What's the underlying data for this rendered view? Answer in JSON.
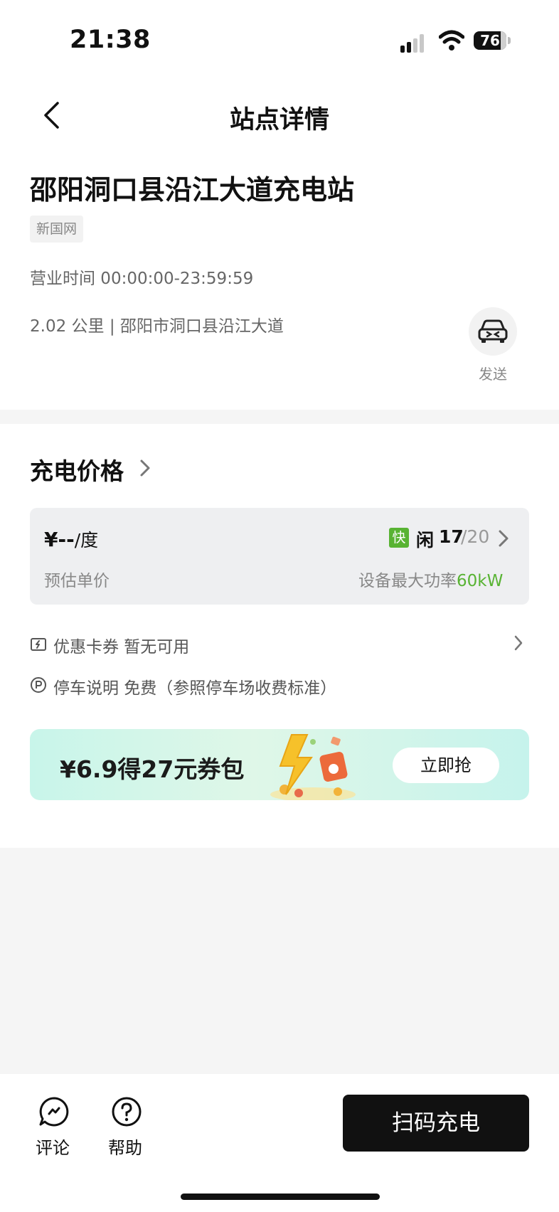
{
  "status_bar": {
    "time": "21:38",
    "battery": "76"
  },
  "header": {
    "title": "站点详情",
    "back_icon": "chevron-left-icon"
  },
  "station": {
    "name": "邵阳洞口县沿江大道充电站",
    "operator_tag": "新国网",
    "hours": "营业时间 00:00:00-23:59:59",
    "address": "2.02 公里 | 邵阳市洞口县沿江大道",
    "send_label": "发送",
    "send_icon": "car-icon"
  },
  "price": {
    "heading": "充电价格",
    "value": "¥--",
    "unit": "/度",
    "sub_label": "预估单价",
    "fast_badge": "快",
    "idle_label": "闲",
    "idle_available": "17",
    "idle_total": "/20",
    "power_label": "设备最大功率",
    "power_value": "60kW",
    "accent_color": "#58b333"
  },
  "coupon": {
    "text": "优惠卡券 暂无可用",
    "icon": "coupon-icon"
  },
  "parking": {
    "text": "停车说明 免费（参照停车场收费标准）",
    "icon": "parking-icon"
  },
  "promo": {
    "text": "¥6.9得27元券包",
    "button": "立即抢"
  },
  "bottom": {
    "comment_label": "评论",
    "help_label": "帮助",
    "scan_button": "扫码充电"
  }
}
